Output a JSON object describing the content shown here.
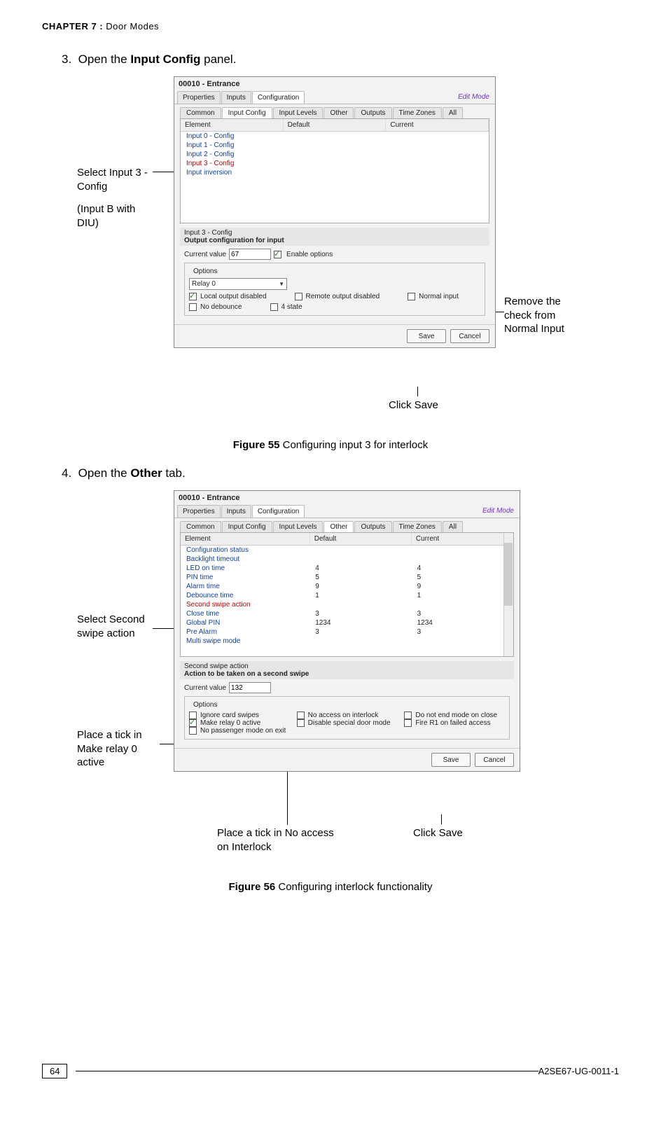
{
  "header": {
    "chapter_label": "CHAPTER 7 :",
    "chapter_title": " Door Modes"
  },
  "step3": {
    "num": "3.",
    "text_pre": "Open the ",
    "text_bold": "Input Config",
    "text_post": " panel."
  },
  "fig55": {
    "window_title": "00010 - Entrance",
    "edit_mode": "Edit Mode",
    "tabs": [
      "Properties",
      "Inputs",
      "Configuration"
    ],
    "subtabs": [
      "Common",
      "Input Config",
      "Input Levels",
      "Other",
      "Outputs",
      "Time Zones",
      "All"
    ],
    "th": [
      "Element",
      "Default",
      "Current"
    ],
    "rows": [
      "Input 0 - Config",
      "Input 1 - Config",
      "Input 2 - Config",
      "Input 3 - Config",
      "Input inversion"
    ],
    "detail_title": "Input 3 - Config",
    "detail_sub": "Output configuration for input",
    "cur_label": "Current value",
    "cur_val": "67",
    "enable": "Enable options",
    "options_title": "Options",
    "dropdown": "Relay 0",
    "checks": {
      "c1": "Local output disabled",
      "c2": "Remote output disabled",
      "c3": "Normal input",
      "c4": "No debounce",
      "c5": "4 state"
    },
    "save": "Save",
    "cancel": "Cancel",
    "callout_left1": "Select Input 3 - Config",
    "callout_left2": "(Input B with DIU)",
    "callout_right": "Remove the check from Normal Input",
    "callout_save": "Click Save",
    "caption_b": "Figure 55",
    "caption_t": " Configuring input 3 for interlock"
  },
  "step4": {
    "num": "4.",
    "text_pre": "Open the ",
    "text_bold": "Other",
    "text_post": " tab."
  },
  "fig56": {
    "window_title": "00010 - Entrance",
    "edit_mode": "Edit Mode",
    "tabs": [
      "Properties",
      "Inputs",
      "Configuration"
    ],
    "subtabs": [
      "Common",
      "Input Config",
      "Input Levels",
      "Other",
      "Outputs",
      "Time Zones",
      "All"
    ],
    "th": [
      "Element",
      "Default",
      "Current"
    ],
    "rows": [
      {
        "name": "Configuration status",
        "d": "",
        "c": ""
      },
      {
        "name": "Backlight timeout",
        "d": "",
        "c": ""
      },
      {
        "name": "LED on time",
        "d": "4",
        "c": "4"
      },
      {
        "name": "PIN time",
        "d": "5",
        "c": "5"
      },
      {
        "name": "Alarm time",
        "d": "9",
        "c": "9"
      },
      {
        "name": "Debounce time",
        "d": "1",
        "c": "1"
      },
      {
        "name": "Second swipe action",
        "d": "",
        "c": ""
      },
      {
        "name": "Close time",
        "d": "3",
        "c": "3"
      },
      {
        "name": "Global PIN",
        "d": "1234",
        "c": "1234"
      },
      {
        "name": "Pre Alarm",
        "d": "3",
        "c": "3"
      },
      {
        "name": "Multi swipe mode",
        "d": "",
        "c": ""
      }
    ],
    "detail_title": "Second swipe action",
    "detail_sub": "Action to be taken on a second swipe",
    "cur_label": "Current value",
    "cur_val": "132",
    "options_title": "Options",
    "checks": {
      "c1": "Ignore card swipes",
      "c2": "No access on interlock",
      "c3": "Do not end mode on close",
      "c4": "Make relay 0 active",
      "c5": "Disable special door mode",
      "c6": "Fire R1 on failed access",
      "c7": "No passenger mode on exit"
    },
    "save": "Save",
    "cancel": "Cancel",
    "callout_left1": "Select Second swipe action",
    "callout_left2": "Place a tick in Make relay 0 active",
    "callout_bot1": "Place a tick in No access on Interlock",
    "callout_bot2": "Click Save",
    "caption_b": "Figure 56",
    "caption_t": " Configuring interlock functionality"
  },
  "footer": {
    "page": "64",
    "docid": "A2SE67-UG-0011-1"
  }
}
